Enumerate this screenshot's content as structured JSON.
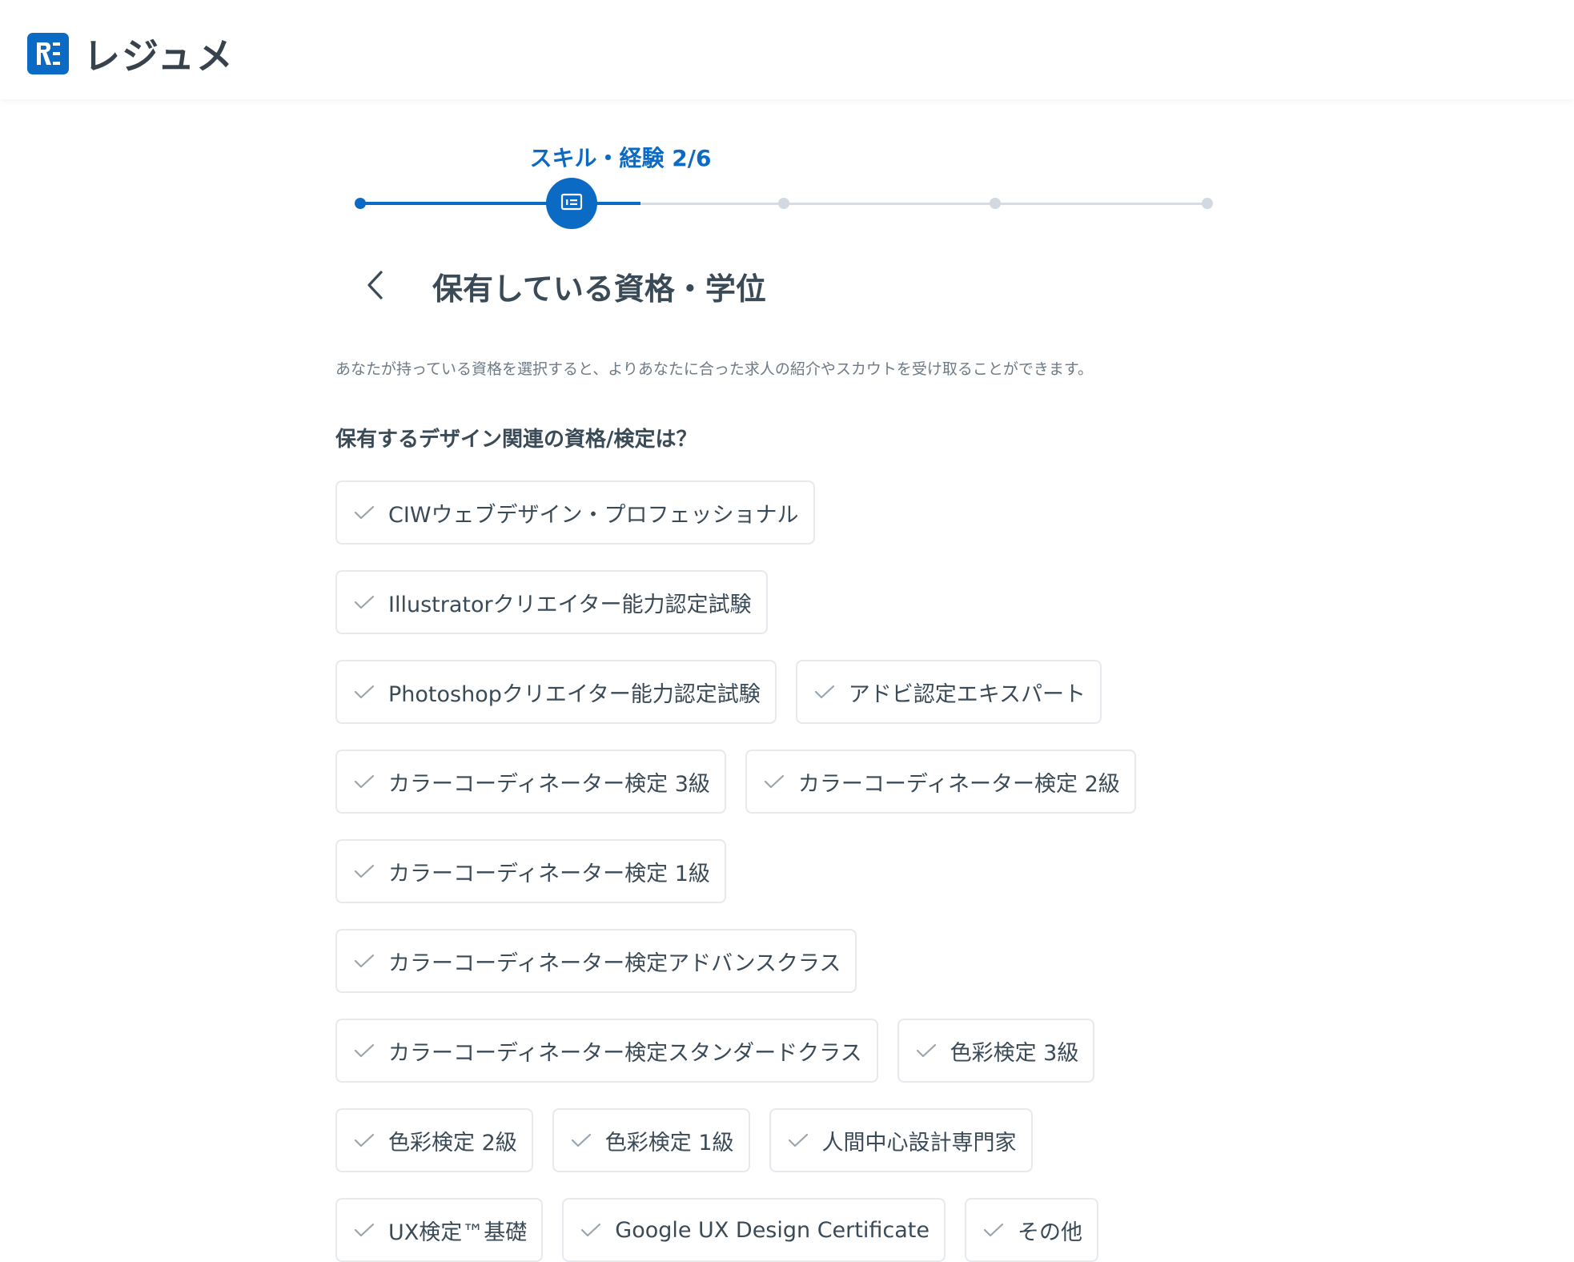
{
  "header": {
    "logo_text": "レジュメ",
    "logo_icon": "resume-logo-icon"
  },
  "stepper": {
    "label": "スキル・経験 2/6",
    "current_step": 2,
    "total_steps": 6,
    "current_icon": "card-icon",
    "accent_color": "#0b6ac4"
  },
  "page": {
    "back_icon": "chevron-left-icon",
    "title": "保有している資格・学位",
    "description": "あなたが持っている資格を選択すると、よりあなたに合った求人の紹介やスカウトを受け取ることができます。",
    "question": "保有するデザイン関連の資格/検定は？"
  },
  "options": [
    {
      "label": "CIWウェブデザイン・プロフェッショナル",
      "selected": false
    },
    {
      "label": "Illustratorクリエイター能力認定試験",
      "selected": false
    },
    {
      "label": "Photoshopクリエイター能力認定試験",
      "selected": false
    },
    {
      "label": "アドビ認定エキスパート",
      "selected": false
    },
    {
      "label": "カラーコーディネーター検定 3級",
      "selected": false
    },
    {
      "label": "カラーコーディネーター検定 2級",
      "selected": false
    },
    {
      "label": "カラーコーディネーター検定 1級",
      "selected": false
    },
    {
      "label": "カラーコーディネーター検定アドバンスクラス",
      "selected": false
    },
    {
      "label": "カラーコーディネーター検定スタンダードクラス",
      "selected": false
    },
    {
      "label": "色彩検定 3級",
      "selected": false
    },
    {
      "label": "色彩検定 2級",
      "selected": false
    },
    {
      "label": "色彩検定 1級",
      "selected": false
    },
    {
      "label": "人間中心設計専門家",
      "selected": false
    },
    {
      "label": "UX検定™基礎",
      "selected": false
    },
    {
      "label": "Google UX Design Certificate",
      "selected": false
    },
    {
      "label": "その他",
      "selected": false
    }
  ]
}
